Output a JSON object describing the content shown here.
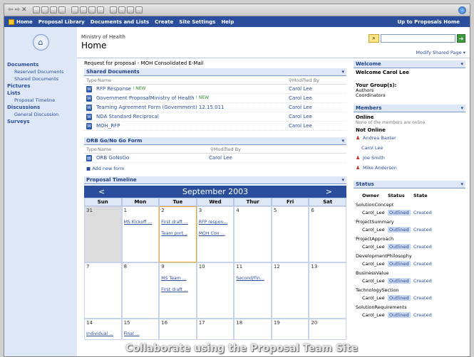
{
  "nav": {
    "items": [
      "Home",
      "Proposal Library",
      "Documents and Lists",
      "Create",
      "Site Settings",
      "Help"
    ],
    "up_link": "Up to Proposals Home"
  },
  "header": {
    "breadcrumb": "Ministry of Health",
    "title": "Home",
    "modify_link": "Modify Shared Page ▾",
    "search_placeholder": ""
  },
  "left_nav": [
    {
      "label": "Documents",
      "type": "head"
    },
    {
      "label": "Reserved Documents",
      "type": "item"
    },
    {
      "label": "Shared Documents",
      "type": "item"
    },
    {
      "label": "Pictures",
      "type": "head"
    },
    {
      "label": "Lists",
      "type": "head"
    },
    {
      "label": "Proposal Timeline",
      "type": "item"
    },
    {
      "label": "Discussions",
      "type": "head"
    },
    {
      "label": "General Discussion",
      "type": "item"
    },
    {
      "label": "Surveys",
      "type": "head"
    }
  ],
  "main": {
    "request_line": "Request for proposal - MOH Consolidated E-Mail",
    "shared_docs": {
      "title": "Shared Documents",
      "col_type": "Type",
      "col_name": "Name",
      "col_modified": "Modified By",
      "rows": [
        {
          "name": "RFP Response",
          "new": "! NEW",
          "by": "Carol Lee"
        },
        {
          "name": "Government ProposalMinistry of Health",
          "new": "! NEW",
          "by": "Carol Lee"
        },
        {
          "name": "Teaming Agreement Form (Government) 12.15.011",
          "new": "",
          "by": "Carol Lee"
        },
        {
          "name": "NDA Standard Reciprocal",
          "new": "",
          "by": "Carol Lee"
        },
        {
          "name": "MOH_RFP",
          "new": "",
          "by": "Carol Lee"
        }
      ]
    },
    "orb": {
      "title": "ORB Go/No Go Form",
      "col_type": "Type",
      "col_name": "Name",
      "col_modified": "Modified By",
      "rows": [
        {
          "name": "ORB GoNoGo",
          "by": "Carol Lee"
        }
      ],
      "add_link": "■ Add new form"
    },
    "timeline": {
      "title": "Proposal Timeline",
      "month": "September 2003",
      "prev": "<",
      "next": ">",
      "days": [
        "Sun",
        "Mon",
        "Tue",
        "Wed",
        "Thur",
        "Fri",
        "Sat"
      ],
      "weeks": [
        [
          {
            "n": "31",
            "other": true,
            "events": []
          },
          {
            "n": "1",
            "events": [
              "MS Kickoff ..."
            ]
          },
          {
            "n": "2",
            "today": true,
            "events": [
              "First draft ...",
              "Team port..."
            ]
          },
          {
            "n": "3",
            "events": [
              "RFP respon...",
              "MOH Con ..."
            ]
          },
          {
            "n": "4",
            "events": []
          },
          {
            "n": "5",
            "events": []
          },
          {
            "n": "6",
            "events": []
          }
        ],
        [
          {
            "n": "7",
            "events": []
          },
          {
            "n": "8",
            "events": []
          },
          {
            "n": "9",
            "events": [
              "MS Team ...",
              "First draft ..."
            ]
          },
          {
            "n": "10",
            "events": []
          },
          {
            "n": "11",
            "events": [
              "Second/Fin..."
            ]
          },
          {
            "n": "12",
            "events": []
          },
          {
            "n": "13",
            "events": []
          }
        ],
        [
          {
            "n": "14",
            "events": [
              "Individual ..."
            ]
          },
          {
            "n": "15",
            "events": [
              "Final ..."
            ]
          },
          {
            "n": "16",
            "events": []
          },
          {
            "n": "17",
            "events": []
          },
          {
            "n": "18",
            "events": []
          },
          {
            "n": "19",
            "events": []
          },
          {
            "n": "20",
            "events": []
          }
        ]
      ]
    }
  },
  "right": {
    "welcome": {
      "title": "Welcome",
      "name": "Welcome Carol Lee",
      "groups_label": "Your Group(s):",
      "groups": [
        "Authors",
        "Coordinators"
      ]
    },
    "members": {
      "title": "Members",
      "online": "Online",
      "online_note": "None of the members are online.",
      "not_online": "Not Online",
      "list": [
        {
          "name": "Andrea Baxter",
          "icon": true
        },
        {
          "name": "Carol Lee",
          "icon": false
        },
        {
          "name": "Joe Smith",
          "icon": true
        },
        {
          "name": "Mike Anderson",
          "icon": true
        }
      ]
    },
    "status": {
      "title": "Status",
      "col_owner": "Owner",
      "col_status": "Status",
      "col_state": "State",
      "sections": [
        {
          "name": "SolutionConcept",
          "owner": "Carol_Lee",
          "status": "Outlined",
          "state": "Created"
        },
        {
          "name": "ProjectSummary",
          "owner": "Carol_Lee",
          "status": "Outlined",
          "state": "Created"
        },
        {
          "name": "ProjectApproach",
          "owner": "Carol_Lee",
          "status": "Outlined",
          "state": "Created"
        },
        {
          "name": "DevelopmentPhilosophy",
          "owner": "Carol_Lee",
          "status": "Outlined",
          "state": "Created"
        },
        {
          "name": "BusinessValue",
          "owner": "Carol_Lee",
          "status": "Outlined",
          "state": "Created"
        },
        {
          "name": "TechnologySection",
          "owner": "Carol_Lee",
          "status": "Outlined",
          "state": "Created"
        },
        {
          "name": "SolutionRequirements",
          "owner": "Carol_Lee",
          "status": "Outlined",
          "state": "Created"
        }
      ]
    }
  },
  "caption": "Collaborate using the Proposal Team Site"
}
